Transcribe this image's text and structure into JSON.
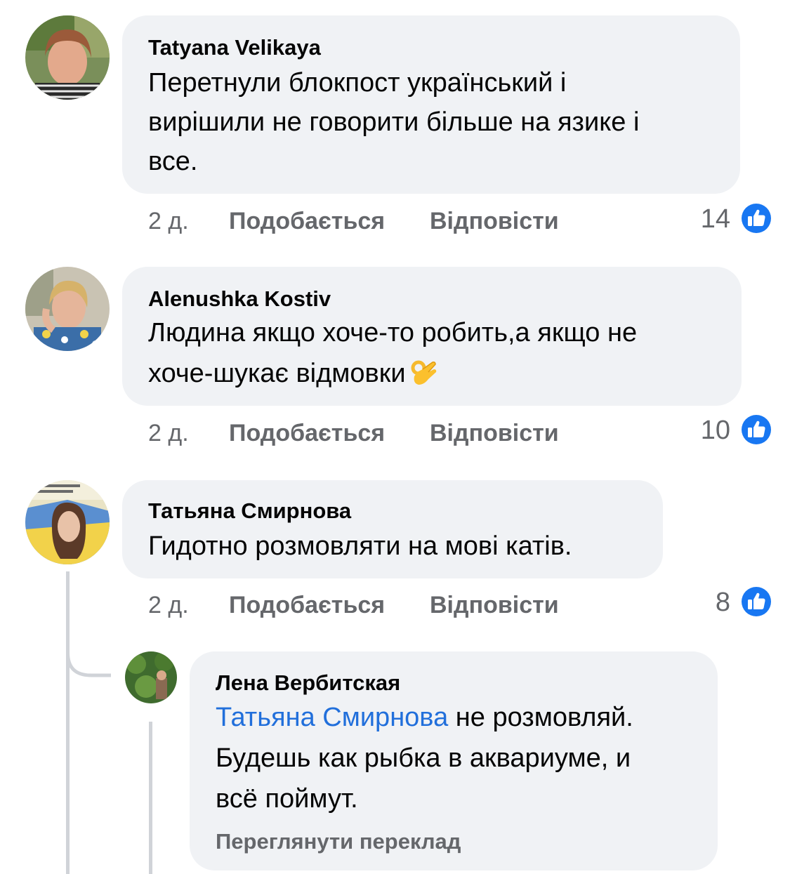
{
  "comments": [
    {
      "author": "Tatyana  Velikaya",
      "lines": [
        "Перетнули блокпост український і",
        "вирішили не говорити більше на язике і",
        "все."
      ],
      "time": "2 д.",
      "like_label": "Подобається",
      "reply_label": "Відповісти",
      "reaction_count": "14",
      "reaction_icon": "like-icon"
    },
    {
      "author": "Alenushka Kostiv",
      "lines": [
        "Людина якщо хоче-то робить,а якщо не",
        "хоче-шукає відмовки"
      ],
      "emoji": "ok-hand-emoji",
      "time": "2 д.",
      "like_label": "Подобається",
      "reply_label": "Відповісти",
      "reaction_count": "10",
      "reaction_icon": "like-icon"
    },
    {
      "author": "Татьяна Смирнова",
      "lines": [
        "Гидотно розмовляти на мові катів."
      ],
      "time": "2 д.",
      "like_label": "Подобається",
      "reply_label": "Відповісти",
      "reaction_count": "8",
      "reaction_icon": "like-icon"
    }
  ],
  "reply": {
    "author": "Лена Вербитская",
    "mention": "Татьяна Смирнова",
    "line1_rest": " не розмовляй.",
    "lines": [
      "Будешь как рыбка в аквариуме, и",
      "всё поймут."
    ],
    "see_translation": "Переглянути переклад"
  },
  "colors": {
    "bubble": "#f0f2f5",
    "meta_text": "#65676b",
    "mention": "#216fdb",
    "like_blue": "#1877f2"
  }
}
